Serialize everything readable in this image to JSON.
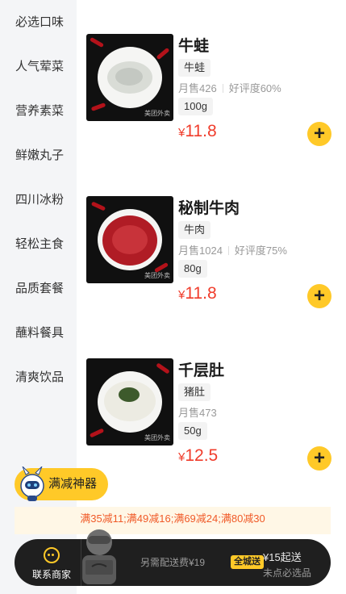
{
  "sidebar": {
    "items": [
      {
        "label": "必选口味"
      },
      {
        "label": "人气荤菜"
      },
      {
        "label": "营养素菜"
      },
      {
        "label": "鲜嫩丸子"
      },
      {
        "label": "四川冰粉"
      },
      {
        "label": "轻松主食"
      },
      {
        "label": "品质套餐"
      },
      {
        "label": "蘸料餐具"
      },
      {
        "label": "清爽饮品"
      }
    ]
  },
  "products": [
    {
      "name": "牛蛙",
      "tag": "牛蛙",
      "sales": "月售426",
      "rating": "好评度60%",
      "spec": "100g",
      "currency": "¥",
      "price": "11.8",
      "add": "+"
    },
    {
      "name": "秘制牛肉",
      "tag": "牛肉",
      "sales": "月售1024",
      "rating": "好评度75%",
      "spec": "80g",
      "currency": "¥",
      "price": "11.8",
      "add": "+"
    },
    {
      "name": "千层肚",
      "tag": "猪肚",
      "sales": "月售473",
      "rating": "",
      "spec": "50g",
      "currency": "¥",
      "price": "12.5",
      "add": "+"
    }
  ],
  "image_watermark": "美团外卖",
  "promo": {
    "label": "满减神器"
  },
  "discount_bar": {
    "text": "满35减11;满49减16;满69减24;满80减30"
  },
  "cart": {
    "contact_label": "联系商家",
    "delivery_text": "另需配送费¥19",
    "badge": "全城送",
    "min_order": "¥15起送",
    "must_item": "未点必选品"
  },
  "colors": {
    "accent": "#ffc928",
    "price": "#f03c2b",
    "discount_text": "#f05a28",
    "cart_bg": "#1f1f1f",
    "sidebar_bg": "#f4f5f7"
  },
  "icons": {
    "add": "plus-icon",
    "contact": "chat-icon",
    "promo": "robot-mascot-icon"
  }
}
